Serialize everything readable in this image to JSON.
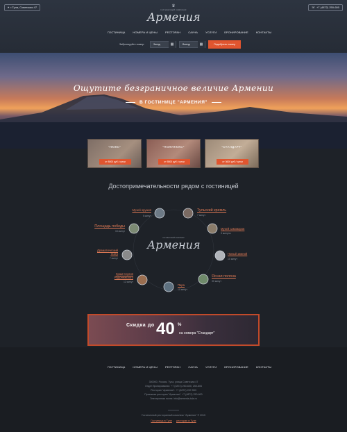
{
  "header": {
    "address": "г.Тула, Советская 47",
    "phone": "+7 (4872) 250-600",
    "logo_small": "гостиничный комплекс",
    "logo_name": "Армения",
    "nav": [
      "ГОСТИНИЦА",
      "НОМЕРА И ЦЕНЫ",
      "РЕСТОРАН",
      "САУНА",
      "УСЛУГИ",
      "БРОНИРОВАНИЕ",
      "КОНТАКТЫ"
    ],
    "booking": {
      "label": "Забронируйте номер:",
      "checkin": "Заезд",
      "checkout": "Выезд",
      "button": "Подобрать номер"
    }
  },
  "hero": {
    "title": "Ощутите безграничное величие Армении",
    "subtitle": "В ГОСТИНИЦЕ \"АРМЕНИЯ\""
  },
  "rooms": [
    {
      "label": "\"ЛЮКС\"",
      "price": "от 8000 руб / сутки"
    },
    {
      "label": "\"ПОЛУЛЮКС\"",
      "price": "от 5500 руб / сутки"
    },
    {
      "label": "\"СТАНДАРТ\"",
      "price": "от 3600 руб / сутки"
    }
  ],
  "attractions": {
    "title": "Достопримечательности рядом с гостиницей",
    "center_small": "гостиничный комплекс",
    "center_name": "Армения",
    "left": [
      {
        "name": "Музей оружия",
        "time": "5 минут"
      },
      {
        "name": "Площадь победы",
        "time": "15 минут"
      },
      {
        "name": "Драматический театр",
        "time": "7 минут"
      },
      {
        "name": "Храм Сергия Радонежского",
        "time": "12 минут"
      }
    ],
    "right": [
      {
        "name": "Тульский кремль",
        "time": "7 минут"
      },
      {
        "name": "Музей самоваров",
        "time": "3 минуты"
      },
      {
        "name": "Новый зимний",
        "time": "10 минут"
      },
      {
        "name": "Ясная поляна",
        "time": "30 минут"
      }
    ],
    "bottom": {
      "name": "Пара",
      "time": "10 минут"
    }
  },
  "discount": {
    "prefix": "Скидка до",
    "value": "40",
    "percent": "%",
    "text": "на номера \"Стандарт\""
  },
  "footer": {
    "nav": [
      "ГОСТИНИЦА",
      "НОМЕРА И ЦЕНЫ",
      "РЕСТОРАН",
      "САУНА",
      "УСЛУГИ",
      "БРОНИРОВАНИЕ",
      "КОНТАКТЫ"
    ],
    "lines": [
      "300000, Россия, Тула, улица Советская 47",
      "Отдел бронирования: +7 (4872) 250-600, 250-606",
      "Ресторан \"Армения\": +7 (4872) 267-553",
      "Приемная ресторан \"Армения\": +7 (4872) 250-600",
      "Электронная почта: info@armenia-tula.ru"
    ],
    "copyright": "Гостиничный ресторанный комплекс \"Армения\" © 2015",
    "links": [
      "Гостиница в Туле",
      "ресторан в Туле"
    ]
  },
  "colors": {
    "accent": "#e0552f",
    "link": "#e07a55",
    "bg": "#1e2228"
  }
}
